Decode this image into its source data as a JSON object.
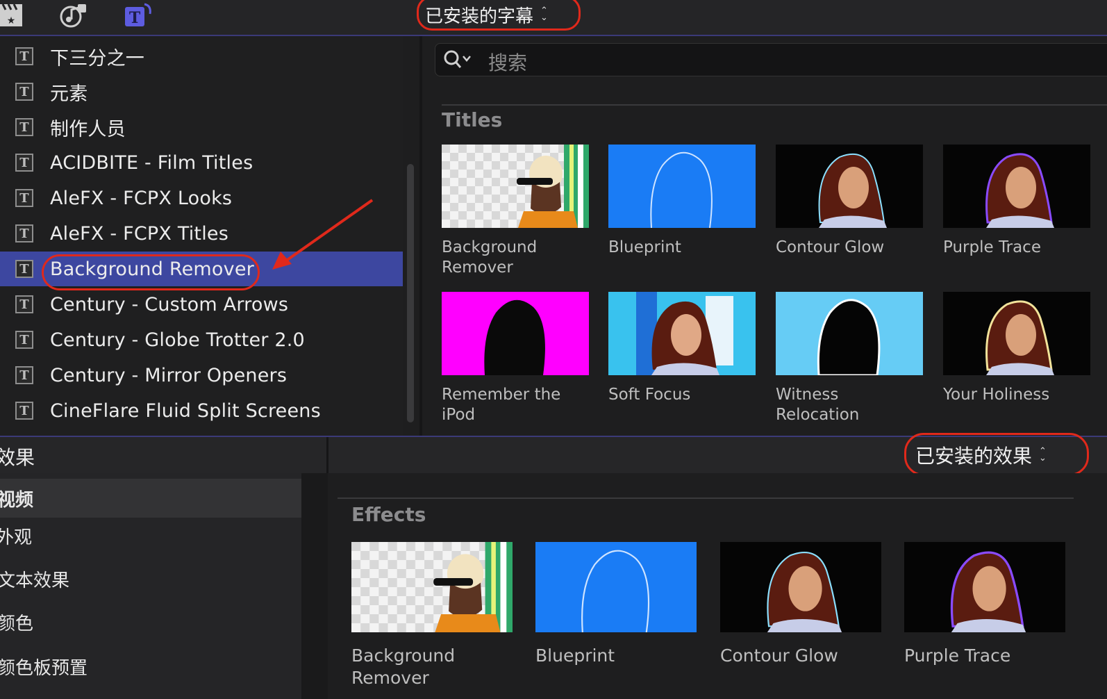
{
  "toolbar": {
    "icons": [
      "clapper-star-icon",
      "music-icon",
      "titles-icon"
    ],
    "titles_popup_label": "已安装的字幕"
  },
  "title_list": {
    "items": [
      {
        "label": "下三分之一"
      },
      {
        "label": "元素"
      },
      {
        "label": "制作人员"
      },
      {
        "label": "ACIDBITE - Film Titles"
      },
      {
        "label": "AleFX - FCPX Looks"
      },
      {
        "label": "AleFX - FCPX Titles"
      },
      {
        "label": "Background Remover",
        "selected": true
      },
      {
        "label": "Century - Custom Arrows"
      },
      {
        "label": "Century - Globe Trotter 2.0"
      },
      {
        "label": "Century - Mirror Openers"
      },
      {
        "label": "CineFlare Fluid Split Screens"
      }
    ],
    "selected_color": "#3d47a0"
  },
  "search": {
    "placeholder": "搜索"
  },
  "titles_section": {
    "heading": "Titles",
    "items": [
      {
        "line1": "Background",
        "line2": "Remover",
        "thumb": "checker"
      },
      {
        "line1": "Blueprint",
        "line2": "",
        "thumb": "blueprint"
      },
      {
        "line1": "Contour Glow",
        "line2": "",
        "thumb": "contour"
      },
      {
        "line1": "Purple Trace",
        "line2": "",
        "thumb": "purple"
      },
      {
        "line1": "Remember the",
        "line2": "iPod",
        "thumb": "ipod"
      },
      {
        "line1": "Soft Focus",
        "line2": "",
        "thumb": "softfocus"
      },
      {
        "line1": "Witness",
        "line2": "Relocation",
        "thumb": "witness"
      },
      {
        "line1": "Your Holiness",
        "line2": "",
        "thumb": "holiness"
      }
    ]
  },
  "effects_bar": {
    "title": "效果",
    "popup_label": "已安装的效果"
  },
  "effect_categories": [
    {
      "label": "视频",
      "selected": true
    },
    {
      "label": "外观"
    },
    {
      "label": "文本效果"
    },
    {
      "label": "颜色"
    },
    {
      "label": "颜色板预置"
    }
  ],
  "effects_section": {
    "heading": "Effects",
    "items": [
      {
        "line1": "Background",
        "line2": "Remover",
        "thumb": "checker"
      },
      {
        "line1": "Blueprint",
        "line2": "",
        "thumb": "blueprint"
      },
      {
        "line1": "Contour Glow",
        "line2": "",
        "thumb": "contour"
      },
      {
        "line1": "Purple Trace",
        "line2": "",
        "thumb": "purple"
      }
    ]
  },
  "colors": {
    "accent_selection": "#3d47a0",
    "annotation_red": "#e0291b",
    "blueprint_blue": "#1a7cf5",
    "ipod_magenta": "#ff00ff",
    "witness_cyan": "#66ccf5"
  }
}
